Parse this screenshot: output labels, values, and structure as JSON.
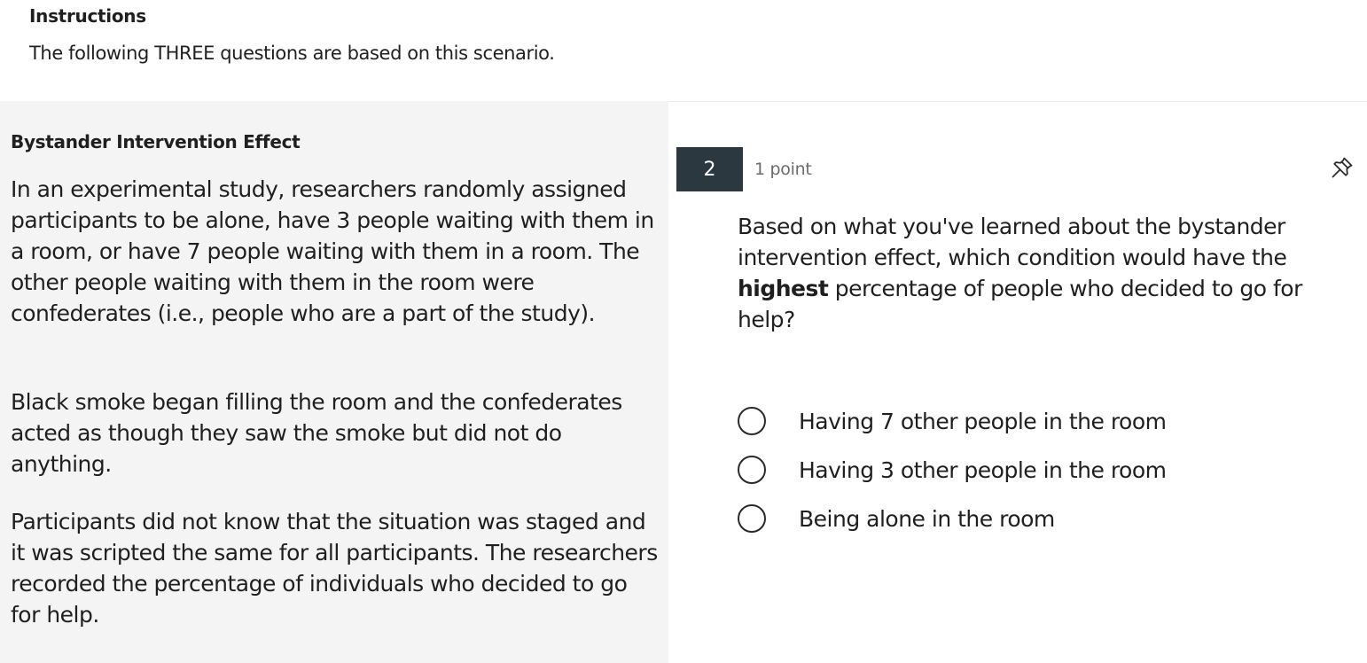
{
  "instructions": {
    "heading": "Instructions",
    "text": "The following THREE questions are based on this scenario."
  },
  "scenario": {
    "title": "Bystander Intervention Effect",
    "paragraphs": [
      "In an experimental study, researchers randomly assigned participants to be alone, have 3 people waiting with them in a room, or have 7 people waiting with them in a room. The other people waiting with them in the room were confederates (i.e., people who are a part of the study).",
      "Black smoke  began filling the room and the confederates acted as though they saw the smoke but did not do anything.",
      "Participants did not know that the situation was staged and it was scripted the same for all participants. The researchers recorded the percentage of individuals who decided to go for help."
    ]
  },
  "question": {
    "number": "2",
    "points": "1 point",
    "text_before": "Based on what you've learned about the bystander intervention effect, which condition would have the ",
    "text_bold": "highest",
    "text_after": " percentage of people who decided to go for help?",
    "pin_icon": "pin-icon",
    "options": [
      {
        "label": "Having 7 other people in the room",
        "selected": false
      },
      {
        "label": "Having 3 other people in the room",
        "selected": false
      },
      {
        "label": "Being alone in the room",
        "selected": false
      }
    ]
  }
}
